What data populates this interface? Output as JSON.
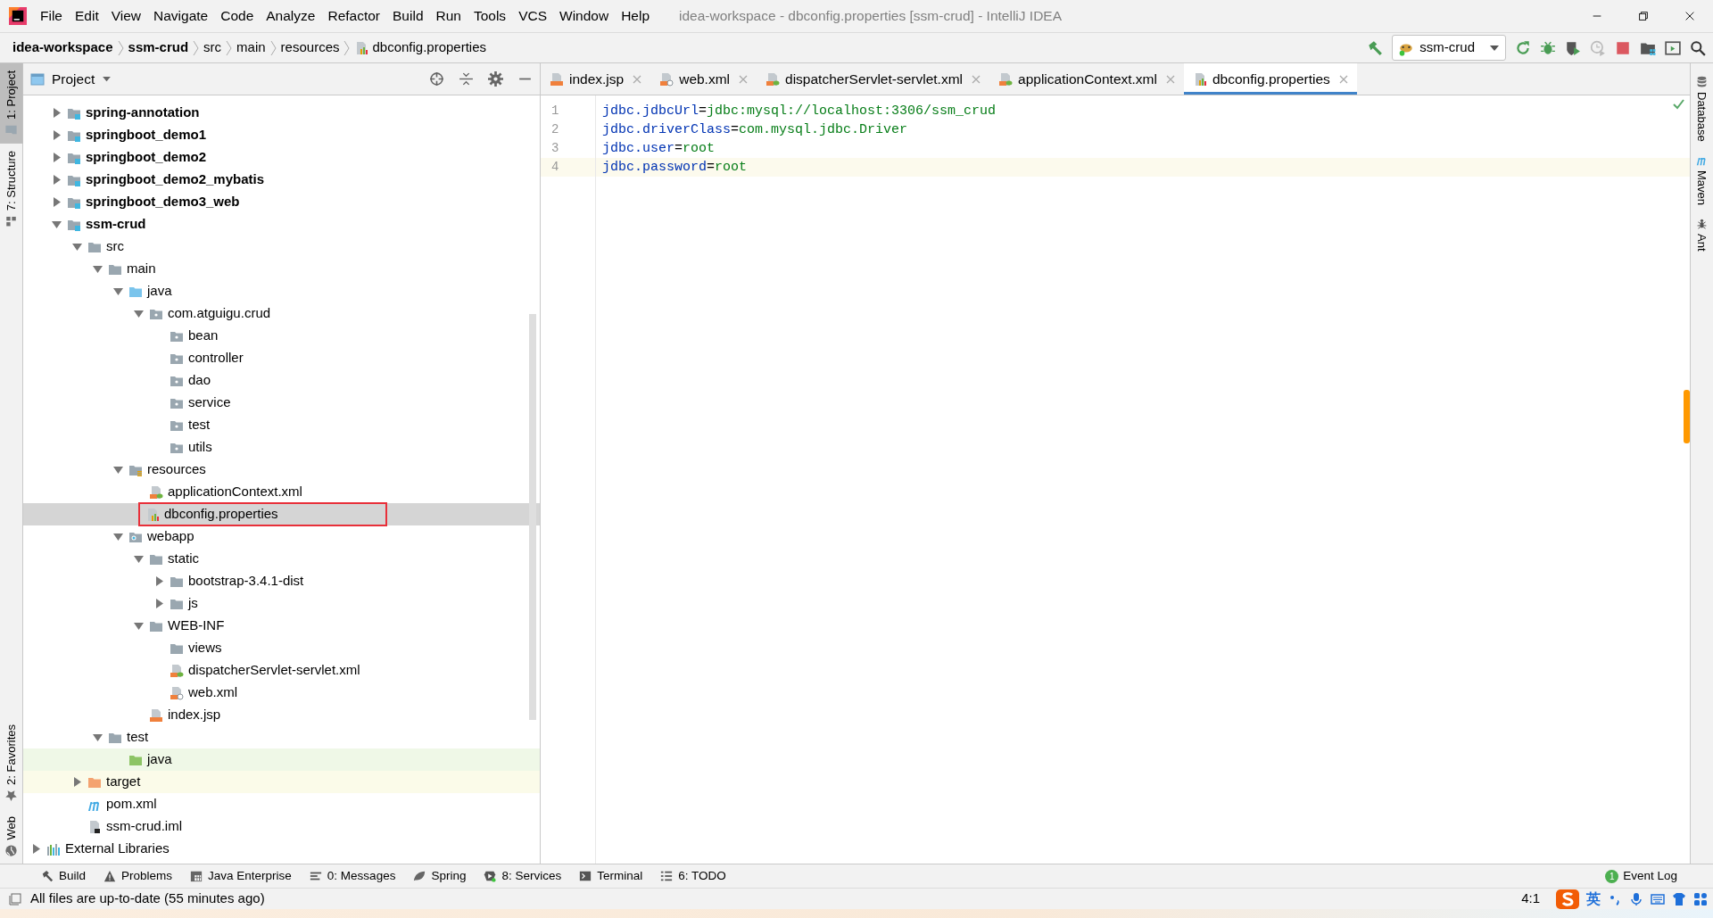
{
  "window": {
    "title": "idea-workspace - dbconfig.properties [ssm-crud] - IntelliJ IDEA"
  },
  "menu": [
    "File",
    "Edit",
    "View",
    "Navigate",
    "Code",
    "Analyze",
    "Refactor",
    "Build",
    "Run",
    "Tools",
    "VCS",
    "Window",
    "Help"
  ],
  "breadcrumb": [
    {
      "label": "idea-workspace",
      "kind": "module"
    },
    {
      "label": "ssm-crud",
      "kind": "module"
    },
    {
      "label": "src",
      "kind": "folder"
    },
    {
      "label": "main",
      "kind": "folder"
    },
    {
      "label": "resources",
      "kind": "folder"
    },
    {
      "label": "dbconfig.properties",
      "kind": "properties"
    }
  ],
  "run_config": {
    "label": "ssm-crud"
  },
  "left_strip": [
    {
      "label": "1: Project",
      "kind": "folder",
      "selected": true
    },
    {
      "label": "7: Structure",
      "kind": "structure",
      "selected": false
    },
    {
      "label": "2: Favorites",
      "kind": "star",
      "selected": false
    },
    {
      "label": "Web",
      "kind": "globe",
      "selected": false
    }
  ],
  "project_panel": {
    "title": "Project"
  },
  "tree": {
    "selection_outlined": true,
    "items": [
      {
        "label": "spring-annotation",
        "kind": "module",
        "expanded": false,
        "selected": false
      },
      {
        "label": "springboot_demo1",
        "kind": "module",
        "expanded": false,
        "selected": false
      },
      {
        "label": "springboot_demo2",
        "kind": "module",
        "expanded": false,
        "selected": false
      },
      {
        "label": "springboot_demo2_mybatis",
        "kind": "module",
        "expanded": false,
        "selected": false
      },
      {
        "label": "springboot_demo3_web",
        "kind": "module",
        "expanded": false,
        "selected": false
      },
      {
        "label": "ssm-crud",
        "kind": "module",
        "expanded": true,
        "selected": false,
        "children": [
          {
            "label": "src",
            "kind": "folder",
            "expanded": true,
            "selected": false,
            "children": [
              {
                "label": "main",
                "kind": "folder",
                "expanded": true,
                "selected": false,
                "children": [
                  {
                    "label": "java",
                    "kind": "source",
                    "expanded": true,
                    "selected": false,
                    "children": [
                      {
                        "label": "com.atguigu.crud",
                        "kind": "package",
                        "expanded": true,
                        "selected": false,
                        "children": [
                          {
                            "label": "bean",
                            "kind": "package",
                            "selected": false
                          },
                          {
                            "label": "controller",
                            "kind": "package",
                            "selected": false
                          },
                          {
                            "label": "dao",
                            "kind": "package",
                            "selected": false
                          },
                          {
                            "label": "service",
                            "kind": "package",
                            "selected": false
                          },
                          {
                            "label": "test",
                            "kind": "package",
                            "selected": false
                          },
                          {
                            "label": "utils",
                            "kind": "package",
                            "selected": false
                          }
                        ]
                      }
                    ]
                  },
                  {
                    "label": "resources",
                    "kind": "resources",
                    "expanded": true,
                    "selected": false,
                    "children": [
                      {
                        "label": "applicationContext.xml",
                        "kind": "spring-xml",
                        "selected": false
                      },
                      {
                        "label": "dbconfig.properties",
                        "kind": "properties",
                        "selected": true
                      }
                    ]
                  },
                  {
                    "label": "webapp",
                    "kind": "webapp",
                    "expanded": true,
                    "selected": false,
                    "children": [
                      {
                        "label": "static",
                        "kind": "folder",
                        "expanded": true,
                        "selected": false,
                        "children": [
                          {
                            "label": "bootstrap-3.4.1-dist",
                            "kind": "folder",
                            "expanded": false,
                            "selected": false
                          },
                          {
                            "label": "js",
                            "kind": "folder",
                            "expanded": false,
                            "selected": false
                          }
                        ]
                      },
                      {
                        "label": "WEB-INF",
                        "kind": "folder",
                        "expanded": true,
                        "selected": false,
                        "children": [
                          {
                            "label": "views",
                            "kind": "folder",
                            "selected": false
                          },
                          {
                            "label": "dispatcherServlet-servlet.xml",
                            "kind": "spring-xml",
                            "selected": false
                          },
                          {
                            "label": "web.xml",
                            "kind": "web-xml",
                            "selected": false
                          }
                        ]
                      },
                      {
                        "label": "index.jsp",
                        "kind": "jsp",
                        "selected": false
                      }
                    ]
                  }
                ]
              },
              {
                "label": "test",
                "kind": "folder",
                "expanded": true,
                "selected": false,
                "children": [
                  {
                    "label": "java",
                    "kind": "test-source",
                    "selected": false
                  }
                ]
              }
            ]
          },
          {
            "label": "target",
            "kind": "excluded",
            "expanded": false,
            "selected": false
          },
          {
            "label": "pom.xml",
            "kind": "maven",
            "selected": false
          },
          {
            "label": "ssm-crud.iml",
            "kind": "iml",
            "selected": false
          }
        ]
      }
    ],
    "external": {
      "label": "External Libraries",
      "kind": "libraries",
      "expanded": false,
      "selected": false
    }
  },
  "tabs": [
    {
      "label": "index.jsp",
      "kind": "jsp",
      "selected": false
    },
    {
      "label": "web.xml",
      "kind": "web-xml",
      "selected": false
    },
    {
      "label": "dispatcherServlet-servlet.xml",
      "kind": "spring-xml",
      "selected": false
    },
    {
      "label": "applicationContext.xml",
      "kind": "spring-xml",
      "selected": false
    },
    {
      "label": "dbconfig.properties",
      "kind": "properties",
      "selected": true
    }
  ],
  "code": [
    {
      "number": "1",
      "key": "jdbc.jdbcUrl",
      "sep": "=",
      "value": "jdbc:mysql://localhost:3306/ssm_crud",
      "current": false
    },
    {
      "number": "2",
      "key": "jdbc.driverClass",
      "sep": "=",
      "value": "com.mysql.jdbc.Driver",
      "current": false
    },
    {
      "number": "3",
      "key": "jdbc.user",
      "sep": "=",
      "value": "root",
      "current": false
    },
    {
      "number": "4",
      "key": "jdbc.password",
      "sep": "=",
      "value": "root",
      "current": true
    }
  ],
  "right_strip": [
    {
      "label": "Database",
      "kind": "database"
    },
    {
      "label": "Maven",
      "kind": "maven"
    },
    {
      "label": "Ant",
      "kind": "ant"
    }
  ],
  "bottom_tools": [
    {
      "label": "Build",
      "kind": "hammer"
    },
    {
      "label": "Problems",
      "kind": "warning"
    },
    {
      "label": "Java Enterprise",
      "kind": "enterprise"
    },
    {
      "label": "0: Messages",
      "kind": "messages"
    },
    {
      "label": "Spring",
      "kind": "leaf"
    },
    {
      "label": "8: Services",
      "kind": "services"
    },
    {
      "label": "Terminal",
      "kind": "terminal"
    },
    {
      "label": "6: TODO",
      "kind": "todo"
    }
  ],
  "event_log": {
    "label": "Event Log",
    "count": "1"
  },
  "status": {
    "message": "All files are up-to-date (55 minutes ago)",
    "position": "4:1"
  },
  "ime": {
    "language": "英"
  }
}
